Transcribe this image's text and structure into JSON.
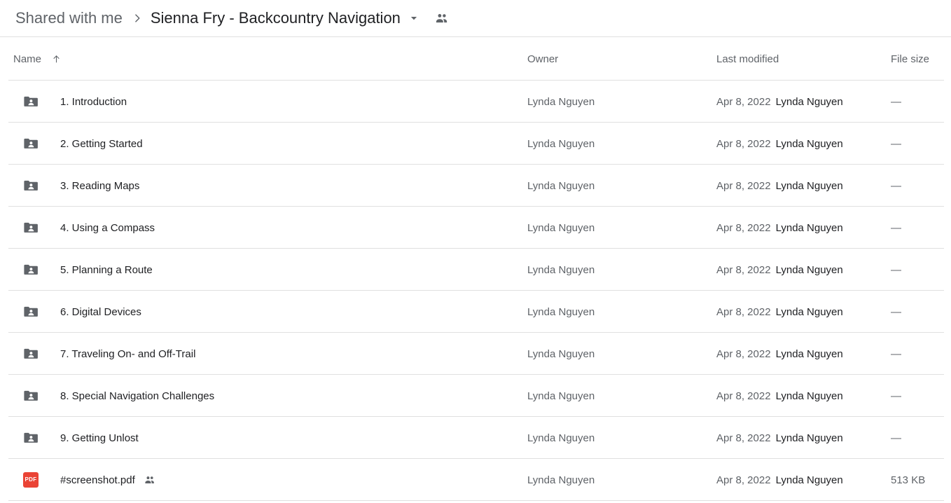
{
  "breadcrumb": {
    "root_label": "Shared with me",
    "separator_icon": "chevron-right-icon",
    "current_label": "Sienna Fry - Backcountry Navigation",
    "caret_icon": "chevron-down-icon",
    "people_icon": "people-icon"
  },
  "colors": {
    "pdf_badge": "#ea4335",
    "folder_icon": "#5f6368",
    "divider": "#e0e0e0",
    "primary_text": "#202124",
    "secondary_text": "#5f6368"
  },
  "table": {
    "columns": {
      "name": "Name",
      "owner": "Owner",
      "modified": "Last modified",
      "size": "File size"
    },
    "sort": {
      "column": "Name",
      "direction": "ascending",
      "icon": "arrow-up-icon"
    },
    "rows": [
      {
        "icon": "shared-folder-icon",
        "name": "1. Introduction",
        "shared": false,
        "owner": "Lynda Nguyen",
        "modified_date": "Apr 8, 2022",
        "modified_by": "Lynda Nguyen",
        "size": "—"
      },
      {
        "icon": "shared-folder-icon",
        "name": "2. Getting Started",
        "shared": false,
        "owner": "Lynda Nguyen",
        "modified_date": "Apr 8, 2022",
        "modified_by": "Lynda Nguyen",
        "size": "—"
      },
      {
        "icon": "shared-folder-icon",
        "name": "3. Reading Maps",
        "shared": false,
        "owner": "Lynda Nguyen",
        "modified_date": "Apr 8, 2022",
        "modified_by": "Lynda Nguyen",
        "size": "—"
      },
      {
        "icon": "shared-folder-icon",
        "name": "4. Using a Compass",
        "shared": false,
        "owner": "Lynda Nguyen",
        "modified_date": "Apr 8, 2022",
        "modified_by": "Lynda Nguyen",
        "size": "—"
      },
      {
        "icon": "shared-folder-icon",
        "name": "5. Planning a Route",
        "shared": false,
        "owner": "Lynda Nguyen",
        "modified_date": "Apr 8, 2022",
        "modified_by": "Lynda Nguyen",
        "size": "—"
      },
      {
        "icon": "shared-folder-icon",
        "name": "6. Digital Devices",
        "shared": false,
        "owner": "Lynda Nguyen",
        "modified_date": "Apr 8, 2022",
        "modified_by": "Lynda Nguyen",
        "size": "—"
      },
      {
        "icon": "shared-folder-icon",
        "name": "7. Traveling On- and Off-Trail",
        "shared": false,
        "owner": "Lynda Nguyen",
        "modified_date": "Apr 8, 2022",
        "modified_by": "Lynda Nguyen",
        "size": "—"
      },
      {
        "icon": "shared-folder-icon",
        "name": "8. Special Navigation Challenges",
        "shared": false,
        "owner": "Lynda Nguyen",
        "modified_date": "Apr 8, 2022",
        "modified_by": "Lynda Nguyen",
        "size": "—"
      },
      {
        "icon": "shared-folder-icon",
        "name": "9. Getting Unlost",
        "shared": false,
        "owner": "Lynda Nguyen",
        "modified_date": "Apr 8, 2022",
        "modified_by": "Lynda Nguyen",
        "size": "—"
      },
      {
        "icon": "pdf-file-icon",
        "icon_label": "PDF",
        "name": "#screenshot.pdf",
        "shared": true,
        "shared_icon": "people-icon",
        "owner": "Lynda Nguyen",
        "modified_date": "Apr 8, 2022",
        "modified_by": "Lynda Nguyen",
        "size": "513 KB"
      }
    ]
  }
}
